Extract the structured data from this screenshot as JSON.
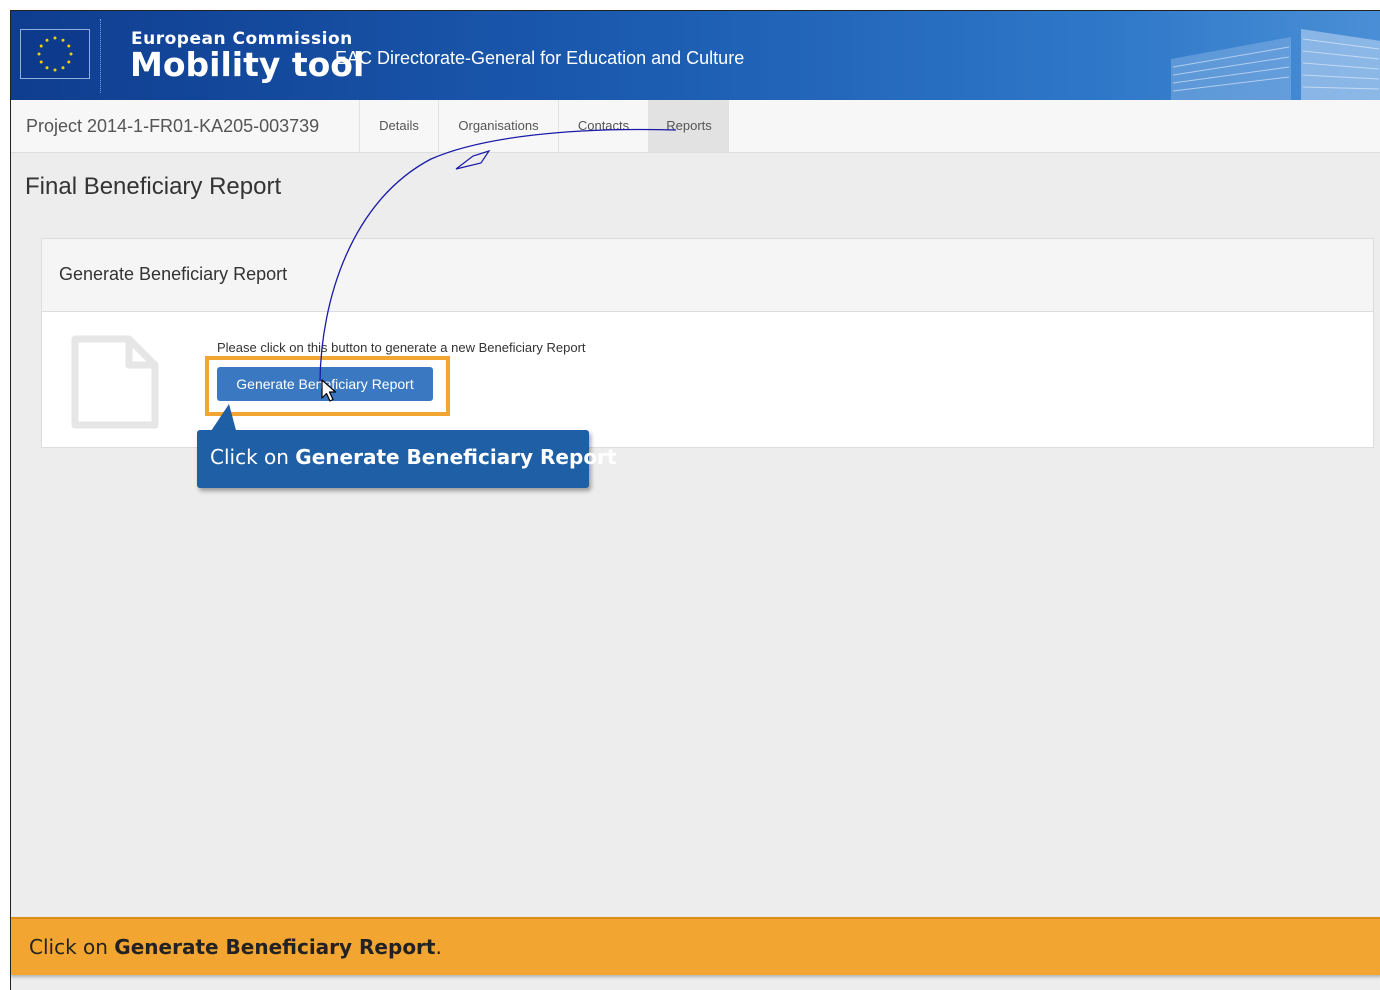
{
  "header": {
    "org_name": "European Commission",
    "app_name": "Mobility tool",
    "dg_name": "EAC Directorate-General for Education and Culture"
  },
  "nav": {
    "project_label": "Project 2014-1-FR01-KA205-003739",
    "tabs": [
      {
        "label": "Details",
        "active": false
      },
      {
        "label": "Organisations",
        "active": false
      },
      {
        "label": "Contacts",
        "active": false
      },
      {
        "label": "Reports",
        "active": true
      }
    ]
  },
  "page": {
    "title": "Final Beneficiary Report"
  },
  "panel": {
    "title": "Generate Beneficiary Report",
    "instruction": "Please click on this button to generate a new Beneficiary Report",
    "button_label": "Generate Beneficiary Report",
    "icon": "document-icon"
  },
  "callout": {
    "prefix": "Click on ",
    "emphasis": "Generate Beneficiary Report"
  },
  "bottom_bar": {
    "prefix": "Click on ",
    "emphasis": "Generate Beneficiary Report",
    "suffix": "."
  },
  "colors": {
    "banner_blue": "#1b5bb0",
    "button_blue": "#3a78c2",
    "callout_blue": "#1e5fa6",
    "highlight_orange": "#f2a531",
    "annotation_line": "#1a1aa8"
  }
}
